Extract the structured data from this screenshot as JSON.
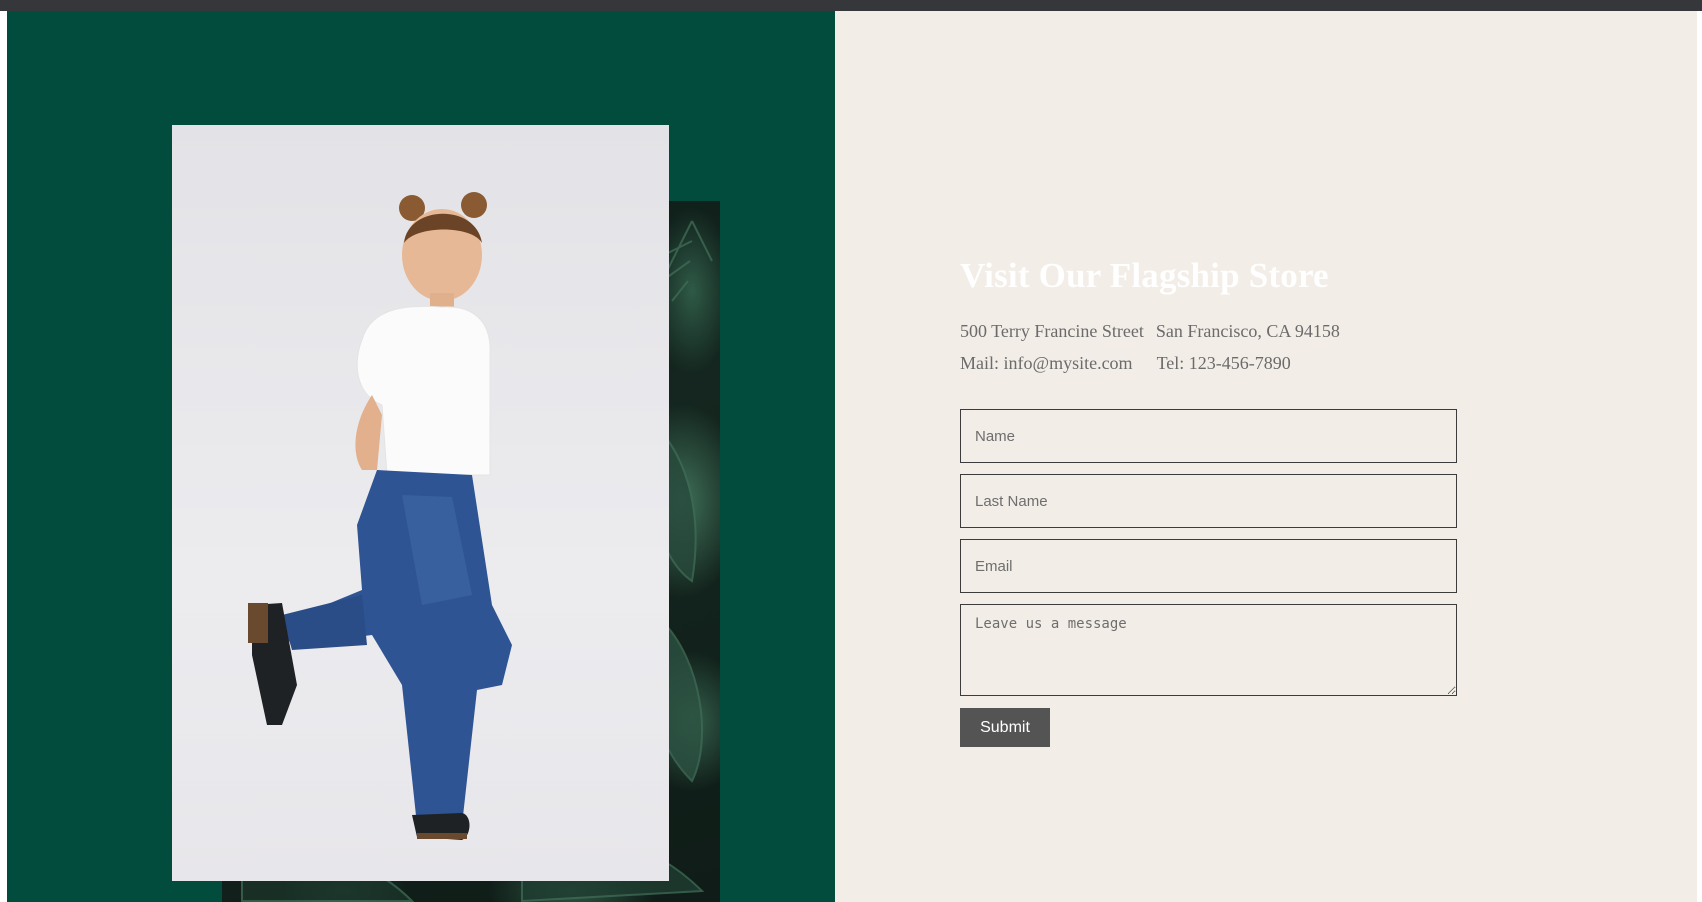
{
  "store": {
    "heading": "Visit Our Flagship Store",
    "street": "500 Terry Francine Street",
    "city": "San Francisco, CA 94158",
    "mail": "Mail: info@mysite.com",
    "tel": "Tel: 123-456-7890"
  },
  "form": {
    "name_placeholder": "Name",
    "last_name_placeholder": "Last Name",
    "email_placeholder": "Email",
    "message_placeholder": "Leave us a message",
    "submit_label": "Submit"
  },
  "colors": {
    "left_panel": "#024c3e",
    "right_panel": "#f2ede7",
    "heading": "#ffffff",
    "button": "#545454",
    "topbar": "#36373b"
  },
  "images": {
    "photo": "girl-posing-in-white-top-and-jeans",
    "backdrop": "dark-tropical-foliage"
  }
}
